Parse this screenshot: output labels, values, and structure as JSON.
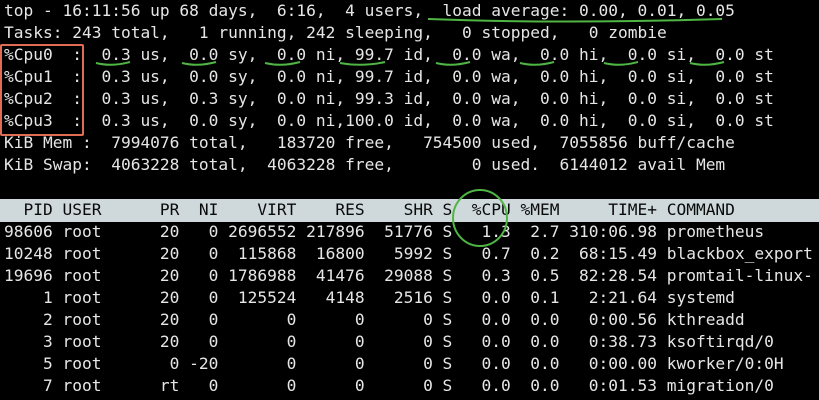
{
  "summary": {
    "top_line": "top - 16:11:56 up 68 days,  6:16,  4 users,  load average: 0.00, 0.01, 0.05",
    "tasks_line": "Tasks: 243 total,   1 running, 242 sleeping,   0 stopped,   0 zombie",
    "cpu_lines": [
      "%Cpu0  :  0.3 us,  0.0 sy,  0.0 ni, 99.7 id,  0.0 wa,  0.0 hi,  0.0 si,  0.0 st",
      "%Cpu1  :  0.3 us,  0.0 sy,  0.0 ni, 99.7 id,  0.0 wa,  0.0 hi,  0.0 si,  0.0 st",
      "%Cpu2  :  0.3 us,  0.3 sy,  0.0 ni, 99.3 id,  0.0 wa,  0.0 hi,  0.0 si,  0.0 st",
      "%Cpu3  :  0.3 us,  0.0 sy,  0.0 ni,100.0 id,  0.0 wa,  0.0 hi,  0.0 si,  0.0 st"
    ],
    "mem_line": "KiB Mem :  7994076 total,   183720 free,   754500 used,  7055856 buff/cache",
    "swap_line": "KiB Swap:  4063228 total,  4063228 free,        0 used.  6144012 avail Mem"
  },
  "process_table": {
    "header": "  PID USER      PR  NI    VIRT    RES    SHR S  %CPU %MEM     TIME+ COMMAND",
    "rows": [
      "98606 root      20   0 2696552 217896  51776 S   1.3  2.7 310:06.98 prometheus",
      "10248 root      20   0  115868  16800   5992 S   0.7  0.2  68:15.49 blackbox_export",
      "19696 root      20   0 1786988  41476  29088 S   0.3  0.5  82:28.54 promtail-linux-",
      "    1 root      20   0  125524   4148   2516 S   0.0  0.1   2:21.64 systemd",
      "    2 root      20   0       0      0      0 S   0.0  0.0   0:00.56 kthreadd",
      "    3 root      20   0       0      0      0 S   0.0  0.0   0:38.73 ksoftirqd/0",
      "    5 root       0 -20       0      0      0 S   0.0  0.0   0:00.00 kworker/0:0H",
      "    7 root      rt   0       0      0      0 S   0.0  0.0   0:01.53 migration/0"
    ]
  },
  "annotation_colors": {
    "box": "#e06c53",
    "markup": "#4fb544"
  }
}
